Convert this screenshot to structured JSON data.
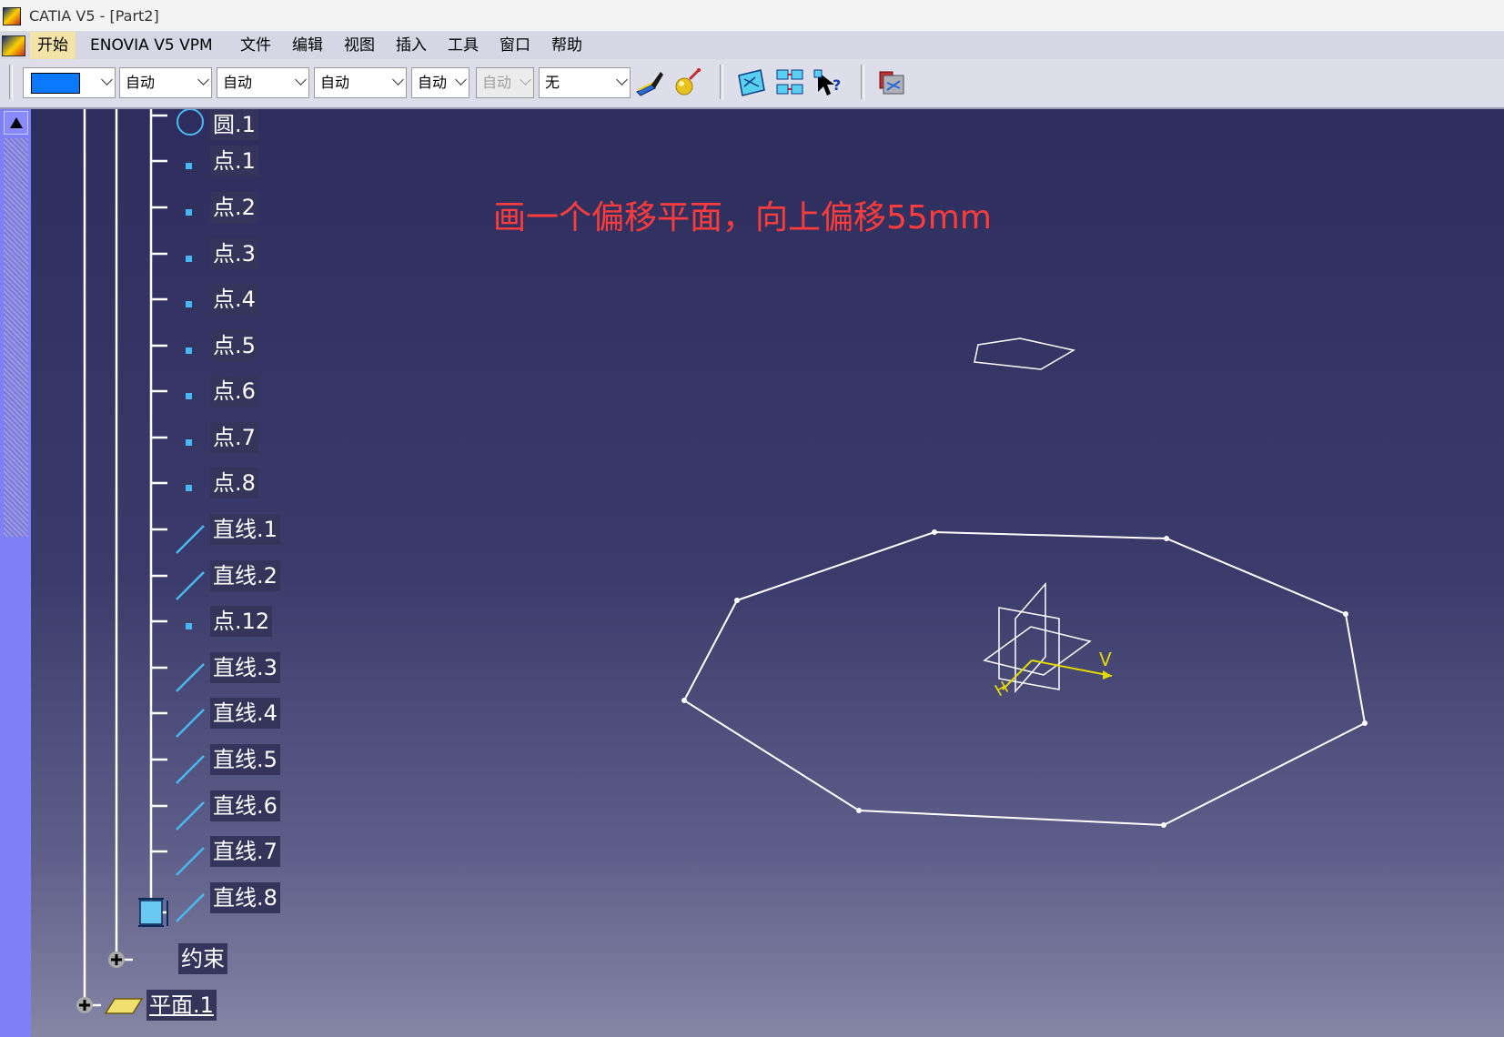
{
  "window": {
    "title": "CATIA V5 - [Part2]"
  },
  "menubar": {
    "items": [
      {
        "label": "开始"
      },
      {
        "label": "ENOVIA V5 VPM"
      },
      {
        "label": "文件"
      },
      {
        "label": "编辑"
      },
      {
        "label": "视图"
      },
      {
        "label": "插入"
      },
      {
        "label": "工具"
      },
      {
        "label": "窗口"
      },
      {
        "label": "帮助"
      }
    ]
  },
  "toolbar": {
    "color_value": "#0a78ff",
    "linetype_value": "自动",
    "thickness_value": "自动",
    "linestyle_value": "自动",
    "combo4_value": "自动",
    "combo5_value": "自动",
    "layer_value": "无",
    "buttons": [
      {
        "icon": "painter-brush-icon"
      },
      {
        "icon": "apply-material-icon"
      },
      {
        "icon": "swap-visible-space-icon"
      },
      {
        "icon": "hide-show-icon"
      },
      {
        "icon": "whats-this-icon"
      },
      {
        "icon": "catalog-browser-icon"
      }
    ]
  },
  "tree": {
    "items": [
      {
        "label": "圆.1",
        "icon": "circle-icon"
      },
      {
        "label": "点.1",
        "icon": "point-icon"
      },
      {
        "label": "点.2",
        "icon": "point-icon"
      },
      {
        "label": "点.3",
        "icon": "point-icon"
      },
      {
        "label": "点.4",
        "icon": "point-icon"
      },
      {
        "label": "点.5",
        "icon": "point-icon"
      },
      {
        "label": "点.6",
        "icon": "point-icon"
      },
      {
        "label": "点.7",
        "icon": "point-icon"
      },
      {
        "label": "点.8",
        "icon": "point-icon"
      },
      {
        "label": "直线.1",
        "icon": "line-icon"
      },
      {
        "label": "直线.2",
        "icon": "line-icon"
      },
      {
        "label": "点.12",
        "icon": "point-icon"
      },
      {
        "label": "直线.3",
        "icon": "line-icon"
      },
      {
        "label": "直线.4",
        "icon": "line-icon"
      },
      {
        "label": "直线.5",
        "icon": "line-icon"
      },
      {
        "label": "直线.6",
        "icon": "line-icon"
      },
      {
        "label": "直线.7",
        "icon": "line-icon"
      },
      {
        "label": "直线.8",
        "icon": "line-icon"
      }
    ],
    "constraints": {
      "label": "约束",
      "icon": "constraints-icon"
    },
    "plane": {
      "label": "平面.1",
      "icon": "plane-icon"
    }
  },
  "annotation": {
    "text": "画一个偏移平面，向上偏移55mm",
    "color": "#ff3c3c"
  },
  "scene": {
    "axis_labels": {
      "v": "V",
      "h": "H"
    },
    "axis_color": "#e0d800",
    "sketch_color": "#ffffff"
  }
}
